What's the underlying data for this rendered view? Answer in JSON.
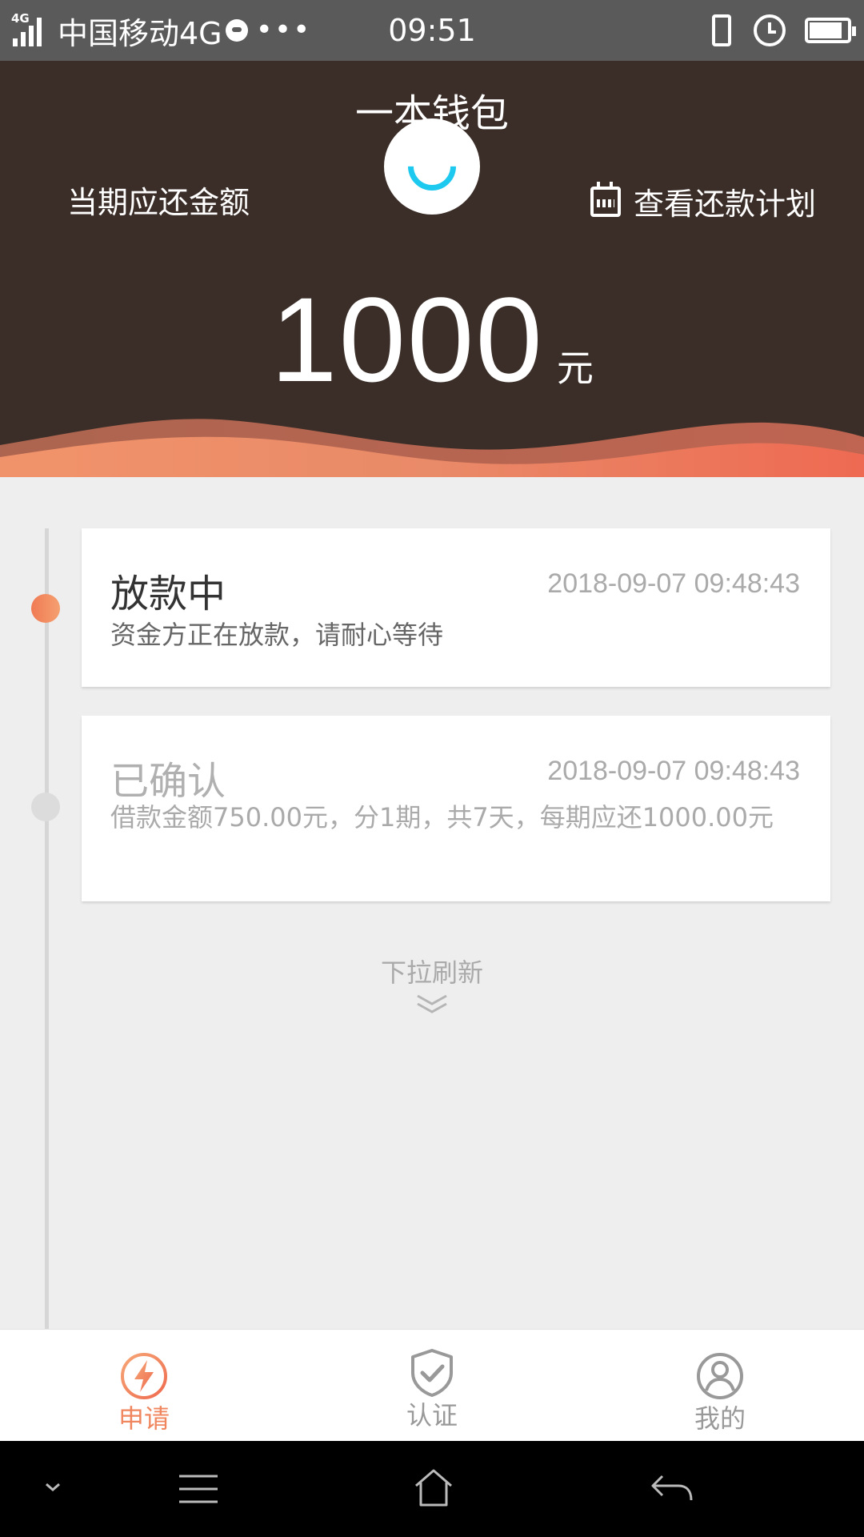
{
  "status_bar": {
    "network_tag": "4G",
    "carrier": "中国移动4G",
    "more": "•••",
    "time": "09:51"
  },
  "header": {
    "title": "一本钱包",
    "due_label": "当期应还金额",
    "plan_link": "查看还款计划",
    "amount": "1000",
    "unit": "元"
  },
  "timeline": [
    {
      "status": "放款中",
      "time": "2018-09-07 09:48:43",
      "desc": "资金方正在放款，请耐心等待",
      "active": true
    },
    {
      "status": "已确认",
      "time": "2018-09-07 09:48:43",
      "desc": "借款金额750.00元，分1期，共7天，每期应还1000.00元",
      "active": false
    }
  ],
  "pull_refresh": "下拉刷新",
  "tabs": [
    {
      "label": "申请",
      "icon": "lightning-icon",
      "active": true
    },
    {
      "label": "认证",
      "icon": "shield-check-icon",
      "active": false
    },
    {
      "label": "我的",
      "icon": "user-icon",
      "active": false
    }
  ],
  "colors": {
    "header_bg": "#3b2e28",
    "accent": "#f0865e",
    "loader": "#1ec9ef"
  }
}
